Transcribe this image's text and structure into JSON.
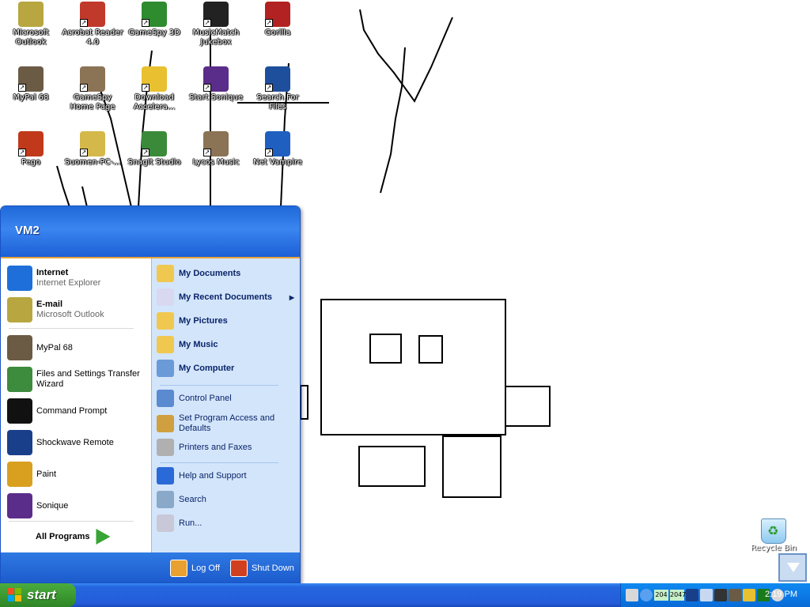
{
  "desktop": {
    "icons": [
      {
        "label": "Microsoft Outlook",
        "icon": "outlook-icon",
        "color": "#b8a640"
      },
      {
        "label": "Acrobat Reader 4.0",
        "icon": "acrobat-icon",
        "color": "#c0392b"
      },
      {
        "label": "GameSpy 3D",
        "icon": "gamespy-icon",
        "color": "#2e8b2e"
      },
      {
        "label": "MusicMatch Jukebox",
        "icon": "musicmatch-icon",
        "color": "#222222"
      },
      {
        "label": "Gorilla",
        "icon": "gorilla-icon",
        "color": "#b22222"
      },
      {
        "label": "MyPal 68",
        "icon": "mypal-icon",
        "color": "#6b5b45"
      },
      {
        "label": "GameSpy Home Page",
        "icon": "gamespy-home-icon",
        "color": "#8b7355"
      },
      {
        "label": "Download Accelera...",
        "icon": "download-accelerator-icon",
        "color": "#e8c030"
      },
      {
        "label": "Start Sonique",
        "icon": "sonique-icon",
        "color": "#5b2d8a"
      },
      {
        "label": "Search For Files",
        "icon": "search-files-icon",
        "color": "#1e4f9c"
      },
      {
        "label": "Pego",
        "icon": "pego-icon",
        "color": "#c0391b"
      },
      {
        "label": "Suomen-PC-...",
        "icon": "suomen-pc-icon",
        "color": "#d4b84a"
      },
      {
        "label": "SnagIt Studio",
        "icon": "snagit-icon",
        "color": "#3a8a3a"
      },
      {
        "label": "Lycos Music",
        "icon": "lycos-music-icon",
        "color": "#8b7355"
      },
      {
        "label": "Net Vampire",
        "icon": "net-vampire-icon",
        "color": "#1f5fc0"
      }
    ],
    "recycle_bin": {
      "label": "Recycle Bin",
      "icon": "recycle-bin-icon"
    }
  },
  "start_menu": {
    "user": "VM2",
    "pinned": [
      {
        "title": "Internet",
        "subtitle": "Internet Explorer",
        "icon": "internet-explorer-icon",
        "color": "#1e6fd9"
      },
      {
        "title": "E-mail",
        "subtitle": "Microsoft Outlook",
        "icon": "outlook-icon",
        "color": "#b8a640"
      }
    ],
    "recent": [
      {
        "label": "MyPal 68",
        "icon": "mypal-icon",
        "color": "#6b5b45"
      },
      {
        "label": "Files and Settings Transfer Wizard",
        "icon": "transfer-wizard-icon",
        "color": "#3d8b3d"
      },
      {
        "label": "Command Prompt",
        "icon": "command-prompt-icon",
        "color": "#111111"
      },
      {
        "label": "Shockwave Remote",
        "icon": "shockwave-icon",
        "color": "#1a3f8a"
      },
      {
        "label": "Paint",
        "icon": "paint-icon",
        "color": "#d9a020"
      },
      {
        "label": "Sonique",
        "icon": "sonique-icon",
        "color": "#5b2d8a"
      }
    ],
    "all_programs": "All Programs",
    "places": [
      {
        "label": "My Documents",
        "icon": "folder-documents-icon",
        "color": "#f0c850",
        "bold": true
      },
      {
        "label": "My Recent Documents",
        "icon": "recent-documents-icon",
        "color": "#d8d8f0",
        "bold": true,
        "submenu": true
      },
      {
        "label": "My Pictures",
        "icon": "folder-pictures-icon",
        "color": "#f0c850",
        "bold": true
      },
      {
        "label": "My Music",
        "icon": "folder-music-icon",
        "color": "#f0c850",
        "bold": true
      },
      {
        "label": "My Computer",
        "icon": "my-computer-icon",
        "color": "#6a9ad8",
        "bold": true
      },
      {
        "label": "Control Panel",
        "icon": "control-panel-icon",
        "color": "#5a8ad0",
        "bold": false
      },
      {
        "label": "Set Program Access and Defaults",
        "icon": "program-defaults-icon",
        "color": "#d0a040",
        "bold": false
      },
      {
        "label": "Printers and Faxes",
        "icon": "printer-icon",
        "color": "#b0b0b0",
        "bold": false
      },
      {
        "label": "Help and Support",
        "icon": "help-icon",
        "color": "#2a6ad8",
        "bold": false
      },
      {
        "label": "Search",
        "icon": "search-icon",
        "color": "#8aa8c8",
        "bold": false
      },
      {
        "label": "Run...",
        "icon": "run-icon",
        "color": "#c8c8d8",
        "bold": false
      }
    ],
    "log_off": "Log Off",
    "shut_down": "Shut Down"
  },
  "taskbar": {
    "start_label": "start",
    "tray_numbers": [
      "204",
      "2047"
    ],
    "clock": "2:19 PM"
  },
  "colors": {
    "taskbar_blue": "#245cd9",
    "start_green": "#3c9a31",
    "log_off_orange": "#e8a030",
    "shut_down_red": "#d04020"
  }
}
